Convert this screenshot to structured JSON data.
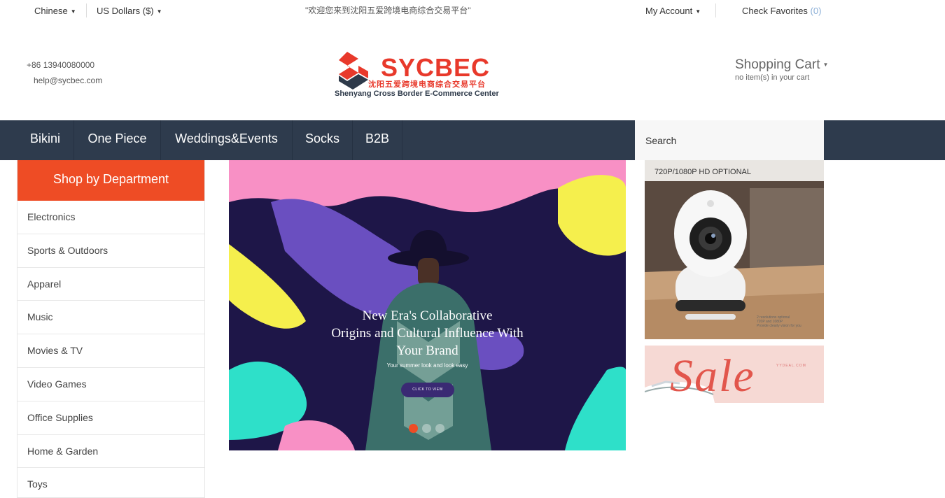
{
  "topbar": {
    "language": "Chinese",
    "currency": "US Dollars ($)",
    "welcome": "\"欢迎您来到沈阳五爱跨境电商综合交易平台\"",
    "account": "My Account",
    "favorites_label": "Check Favorites",
    "favorites_count": "(0)"
  },
  "header": {
    "phone": "+86 13940080000",
    "email": "help@sycbec.com",
    "logo": {
      "brand": "SYCBEC",
      "subtitle_cn": "沈阳五爱跨境电商综合交易平台",
      "subtitle_en": "Shenyang Cross Border E-Commerce Center"
    },
    "cart": {
      "title": "Shopping Cart",
      "status": "no item(s) in your cart"
    }
  },
  "nav": {
    "items": [
      "Bikini",
      "One Piece",
      "Weddings&Events",
      "Socks",
      "B2B"
    ],
    "search_placeholder": "Search"
  },
  "sidebar": {
    "title": "Shop by Department",
    "items": [
      "Electronics",
      "Sports & Outdoors",
      "Apparel",
      "Music",
      "Movies & TV",
      "Video Games",
      "Office Supplies",
      "Home & Garden",
      "Toys"
    ]
  },
  "banner": {
    "headline_1": "New Era's Collaborative",
    "headline_2": "Origins and Cultural Influence With",
    "headline_3": "Your Brand",
    "tagline": "Your summer look and look easy",
    "cta": "CLICK TO VIEW",
    "slides": 3,
    "active_slide": 1
  },
  "promos": {
    "camera_label": "720P/1080P HD OPTIONAL",
    "camera_fine_1": "2 resolutions optional",
    "camera_fine_2": "720P and 1080P",
    "camera_fine_3": "Provide clearly vision for you",
    "sale_word": "Sale",
    "sale_small": "YYDEAL.COM"
  },
  "colors": {
    "accent": "#ee4c25",
    "nav_bg": "#2e3b4d",
    "logo_red": "#e8392b"
  }
}
